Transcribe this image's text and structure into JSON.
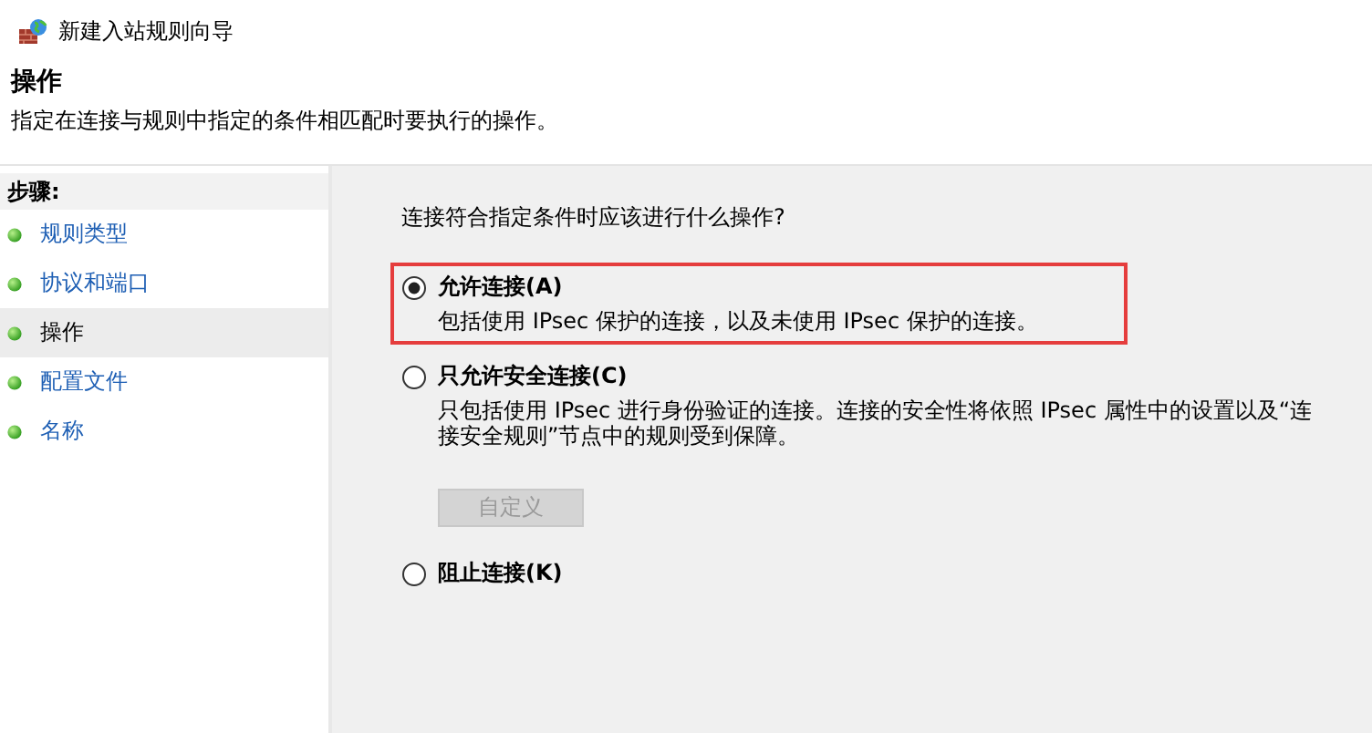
{
  "window": {
    "title": "新建入站规则向导"
  },
  "header": {
    "title": "操作",
    "subtitle": "指定在连接与规则中指定的条件相匹配时要执行的操作。"
  },
  "sidebar": {
    "heading": "步骤:",
    "items": [
      {
        "label": "规则类型",
        "selected": false
      },
      {
        "label": "协议和端口",
        "selected": false
      },
      {
        "label": "操作",
        "selected": true
      },
      {
        "label": "配置文件",
        "selected": false
      },
      {
        "label": "名称",
        "selected": false
      }
    ]
  },
  "content": {
    "question": "连接符合指定条件时应该进行什么操作?",
    "options": [
      {
        "label": "允许连接(A)",
        "selected": true,
        "highlighted": true,
        "description": "包括使用 IPsec 保护的连接，以及未使用 IPsec 保护的连接。"
      },
      {
        "label": "只允许安全连接(C)",
        "selected": false,
        "highlighted": false,
        "description": "只包括使用 IPsec 进行身份验证的连接。连接的安全性将依照 IPsec 属性中的设置以及“连接安全规则”节点中的规则受到保障。",
        "button": {
          "label": "自定义",
          "disabled": true
        }
      },
      {
        "label": "阻止连接(K)",
        "selected": false,
        "highlighted": false
      }
    ]
  }
}
